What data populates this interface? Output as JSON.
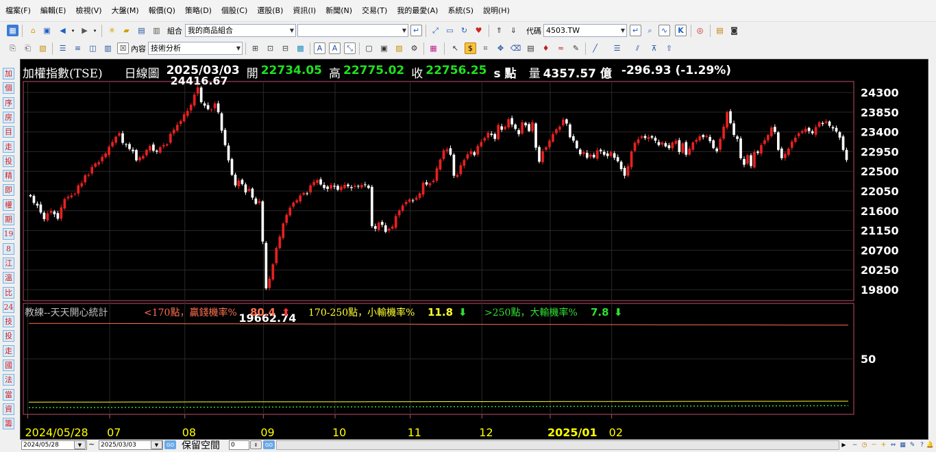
{
  "menu": [
    "檔案(F)",
    "編輯(E)",
    "檢視(V)",
    "大盤(M)",
    "報價(Q)",
    "策略(D)",
    "個股(C)",
    "選股(B)",
    "資訊(I)",
    "新聞(N)",
    "交易(T)",
    "我的最愛(A)",
    "系統(S)",
    "說明(H)"
  ],
  "toolbar1": {
    "group_label": "組合",
    "group_value": "我的商品組合",
    "code_label": "代碼",
    "code_value": "4503.TW"
  },
  "toolbar2": {
    "content_label": "內容",
    "content_value": "技術分析"
  },
  "sidebar": [
    "加",
    "個",
    "序",
    "房",
    "目",
    "走",
    "投",
    "精",
    "即",
    "權",
    "期",
    "19",
    "8",
    "江",
    "溫",
    "比",
    "24",
    "技",
    "投",
    "走",
    "國",
    "法",
    "當",
    "資",
    "籌"
  ],
  "quote": {
    "name": "加權指數(TSE)",
    "period": "日線圖",
    "date": "2025/03/03",
    "open_label": "開",
    "open": "22734.05",
    "high_label": "高",
    "high": "22775.02",
    "close_label": "收",
    "close": "22756.25",
    "unit": "s 點",
    "volume_label": "量",
    "volume": "4357.57 億",
    "change": "-296.93 (-1.29%)"
  },
  "indicator": {
    "title": "教練--天天開心統計",
    "s1_label": "<170點，贏錢機率%",
    "s1_value": "80.4",
    "s2_label": "170-250點，小輸機率%",
    "s2_value": "11.8",
    "s3_label": ">250點，大輸機率%",
    "s3_value": "7.8"
  },
  "bottom": {
    "start_date": "2024/05/28",
    "end_date": "2025/03/03",
    "reserve_label": "保留空間",
    "reserve_value": "0"
  },
  "colors": {
    "up": "#e8201f",
    "down": "#ffffff",
    "quote_green": "#1fe21f",
    "s1": "#ff7050",
    "s2": "#ffff30",
    "s3": "#30e030",
    "axis_x": "#ffff00"
  },
  "chart_data": {
    "type": "candlestick",
    "price_ticks": [
      24300,
      23850,
      23400,
      22950,
      22500,
      22050,
      21600,
      21150,
      20700,
      20250,
      19800
    ],
    "indicator_ticks": [
      50
    ],
    "x_labels": [
      "2024/05/28",
      "07",
      "08",
      "09",
      "10",
      "11",
      "12",
      "2025/01",
      "02"
    ],
    "annotations": [
      {
        "text": "24416.67",
        "value": 24416.67
      },
      {
        "text": "19662.74",
        "value": 19662.74
      }
    ],
    "indicator_series": [
      {
        "name": "<170點，贏錢機率%",
        "start": 82,
        "end": 80.4
      },
      {
        "name": "170-250點，小輸機率%",
        "start": 11,
        "end": 11.8
      },
      {
        "name": ">250點，大輸機率%",
        "start": 6,
        "end": 7.8
      }
    ],
    "closes": [
      21930,
      21780,
      21720,
      21560,
      21410,
      21540,
      21600,
      21520,
      21420,
      21680,
      21870,
      21920,
      21950,
      21990,
      22180,
      22230,
      22410,
      22420,
      22600,
      22680,
      22710,
      22830,
      22910,
      23060,
      23170,
      23290,
      23370,
      23150,
      23110,
      23010,
      22960,
      22750,
      22820,
      22850,
      22990,
      23080,
      22970,
      22950,
      23050,
      23100,
      23120,
      23360,
      23450,
      23560,
      23650,
      23800,
      23880,
      24020,
      24250,
      24416,
      24080,
      24000,
      23920,
      23910,
      24050,
      23850,
      23430,
      23100,
      22750,
      22420,
      22180,
      22290,
      22210,
      22020,
      22100,
      21900,
      21760,
      21820,
      20900,
      19830,
      20050,
      20380,
      20750,
      21010,
      21310,
      21510,
      21670,
      21790,
      21840,
      21950,
      22010,
      21990,
      22180,
      22260,
      22300,
      22200,
      22120,
      22100,
      22190,
      22150,
      22080,
      22150,
      22190,
      22160,
      22120,
      22170,
      22160,
      22190,
      22190,
      22120,
      21250,
      21190,
      21330,
      21280,
      21120,
      21190,
      21240,
      21480,
      21610,
      21720,
      21800,
      21860,
      21830,
      21900,
      22000,
      22240,
      22200,
      22230,
      22290,
      22570,
      22770,
      22980,
      23000,
      22880,
      22400,
      22420,
      22640,
      22760,
      22890,
      22960,
      22870,
      23080,
      23170,
      23260,
      23380,
      23330,
      23240,
      23560,
      23450,
      23520,
      23690,
      23570,
      23470,
      23350,
      23620,
      23550,
      23420,
      23620,
      23040,
      22720,
      22960,
      23050,
      23200,
      23350,
      23460,
      23520,
      23680,
      23590,
      23280,
      23200,
      23030,
      22890,
      22940,
      22810,
      22880,
      22820,
      22980,
      22960,
      22880,
      22850,
      22940,
      22810,
      22730,
      22550,
      22400,
      22620,
      22950,
      23150,
      23230,
      23300,
      23260,
      23280,
      23270,
      23200,
      23100,
      23160,
      23070,
      23030,
      23160,
      23200,
      22940,
      23140,
      22880,
      23020,
      23160,
      23220,
      23300,
      23280,
      23310,
      23190,
      23030,
      22960,
      23240,
      23520,
      23850,
      23600,
      23330,
      23240,
      22800,
      22650,
      22870,
      22620,
      22940,
      22920,
      23100,
      23210,
      23330,
      23500,
      23400,
      22990,
      22800,
      22900,
      23020,
      23180,
      23270,
      23370,
      23420,
      23470,
      23420,
      23370,
      23510,
      23620,
      23580,
      23640,
      23540,
      23480,
      23410,
      23270,
      22990,
      22760
    ]
  }
}
